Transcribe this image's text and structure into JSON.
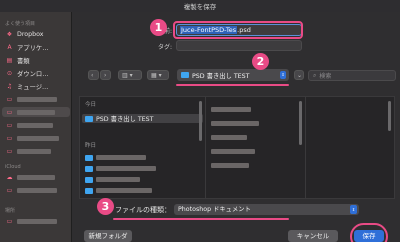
{
  "window": {
    "title": "複製を保存"
  },
  "sidebar": {
    "section_favorites": "よく使う項目",
    "items": [
      {
        "label": "Dropbox",
        "icon": "dropbox-icon"
      },
      {
        "label": "アプリケ…",
        "icon": "apps-icon"
      },
      {
        "label": "書類",
        "icon": "document-icon"
      },
      {
        "label": "ダウンロ…",
        "icon": "download-icon"
      },
      {
        "label": "ミュージ…",
        "icon": "music-icon"
      }
    ],
    "section_icloud": "iCloud",
    "section_location": "場所"
  },
  "form": {
    "name_label": "名前:",
    "name_value_selected": "Juce-FontPSD-Tes",
    "name_value_ext": ".psd",
    "tag_label": "タグ:",
    "location": "PSD 書き出し TEST",
    "search_placeholder": "検索"
  },
  "browser": {
    "today_header": "今日",
    "today_items": [
      "PSD 書き出し TEST"
    ],
    "yesterday_header": "昨日"
  },
  "file_type": {
    "label": "ファイルの種類：",
    "value": "Photoshop ドキュメント"
  },
  "buttons": {
    "new_folder": "新規フォルダ",
    "cancel": "キャンセル",
    "save": "保存"
  },
  "annotations": {
    "step1": "1",
    "step2": "2",
    "step3": "3"
  },
  "colors": {
    "accent": "#2f6fd8",
    "highlight": "#e94b86",
    "folder": "#3fa5f0"
  }
}
